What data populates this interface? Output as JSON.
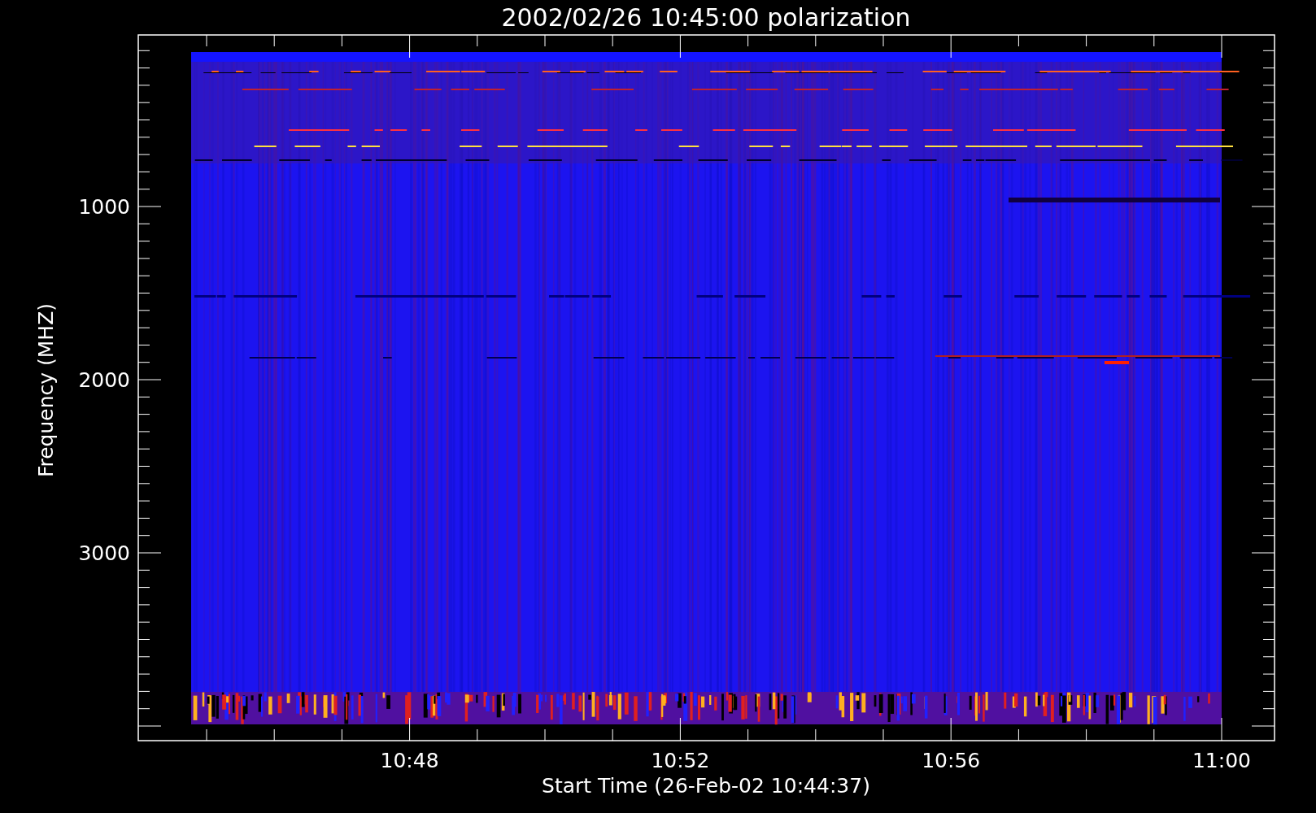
{
  "plot": {
    "title": "2002/02/26 10:45:00 polarization",
    "xlabel": "Start Time (26-Feb-02 10:44:37)",
    "ylabel": "Frequency (MHZ)",
    "xtick_labels": [
      "10:48",
      "10:52",
      "10:56",
      "11:00"
    ],
    "ytick_labels": [
      "1000",
      "2000",
      "3000"
    ]
  }
}
